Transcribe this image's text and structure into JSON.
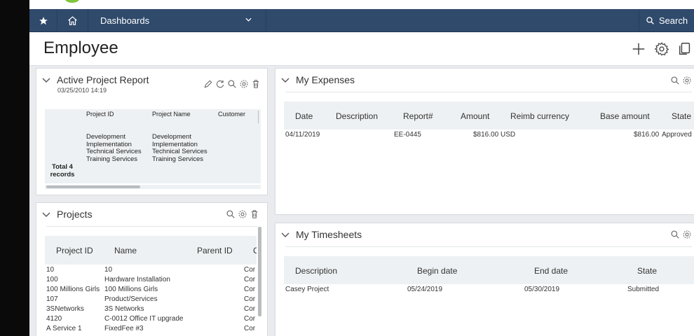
{
  "nav": {
    "dashboards_label": "Dashboards",
    "search_label": "Search"
  },
  "page": {
    "title": "Employee"
  },
  "active_project_report": {
    "title": "Active Project Report",
    "timestamp": "03/25/2010 14:19",
    "columns": [
      "Project ID",
      "Project Name",
      "Customer"
    ],
    "project_ids": [
      "Development",
      "Implementation",
      "Technical Services",
      "Training Services"
    ],
    "project_names": [
      "Development",
      "Implementation",
      "Technical Services",
      "Training Services"
    ],
    "total_label": "Total 4",
    "records_label": "records"
  },
  "projects": {
    "title": "Projects",
    "columns": [
      "Project ID",
      "Name",
      "Parent ID",
      "C"
    ],
    "rows": [
      {
        "id": "10",
        "name": "10",
        "c": "Cor"
      },
      {
        "id": "100",
        "name": "Hardware Installation",
        "c": "Cor"
      },
      {
        "id": "100 Millions Girls",
        "name": "100 Millions Girls",
        "c": "Cor"
      },
      {
        "id": "107",
        "name": "Product/Services",
        "c": "Cor"
      },
      {
        "id": "3SNetworks",
        "name": "3S Networks",
        "c": "Cor"
      },
      {
        "id": "4120",
        "name": "C-0012 Office IT upgrade",
        "c": "Cor"
      },
      {
        "id": "A Service 1",
        "name": "FixedFee #3",
        "c": "Cor"
      }
    ]
  },
  "expenses": {
    "title": "My Expenses",
    "columns": [
      "Date",
      "Description",
      "Report#",
      "Amount",
      "Reimb currency",
      "Base amount",
      "State"
    ],
    "row": {
      "date": "04/11/2019",
      "report": "EE-0445",
      "amount": "$816.00",
      "currency": "USD",
      "base_amount": "$816.00",
      "state": "Approved"
    }
  },
  "timesheets": {
    "title": "My Timesheets",
    "columns": [
      "Description",
      "Begin date",
      "End date",
      "State"
    ],
    "row": {
      "description": "Casey Project",
      "begin": "05/24/2019",
      "end": "05/30/2019",
      "state": "Submitted"
    }
  },
  "colors": {
    "nav_bg": "#2f4a6b",
    "table_header_bg": "#eef1f3",
    "logo_green": "#7fc63b"
  },
  "icons": [
    "star-icon",
    "home-icon",
    "chevron-down-icon",
    "search-icon",
    "plus-icon",
    "gear-icon",
    "copy-icon",
    "pencil-icon",
    "refresh-icon",
    "trash-icon"
  ]
}
